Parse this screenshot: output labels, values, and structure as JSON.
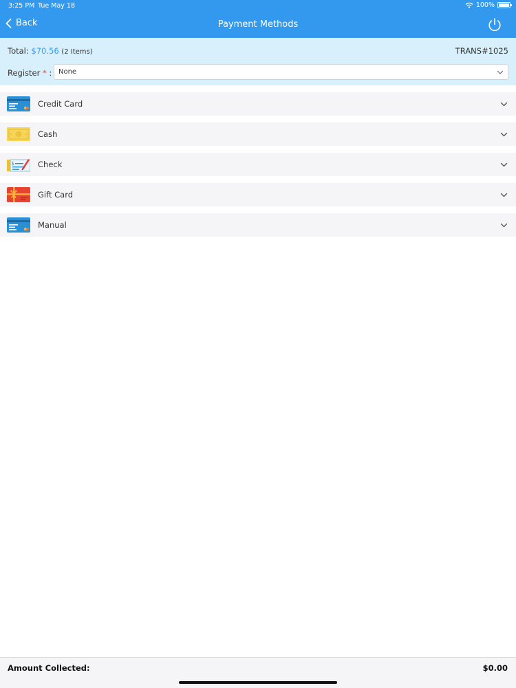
{
  "status_bar": {
    "time": "3:25 PM",
    "date": "Tue May 18",
    "battery_text": "100%",
    "battery_level": 1.0
  },
  "nav": {
    "back_label": "Back",
    "title": "Payment Methods"
  },
  "summary": {
    "total_label": "Total:",
    "total_amount": "$70.56",
    "items_text": "(2 Items)",
    "trans_id": "TRANS#1025",
    "register_label": "Register",
    "required_mark": "*",
    "register_colon": ":",
    "register_value": "None"
  },
  "methods": [
    {
      "label": "Credit Card",
      "icon": "credit-card-icon"
    },
    {
      "label": "Cash",
      "icon": "cash-icon"
    },
    {
      "label": "Check",
      "icon": "check-icon"
    },
    {
      "label": "Gift Card",
      "icon": "gift-card-icon"
    },
    {
      "label": "Manual",
      "icon": "manual-card-icon"
    }
  ],
  "footer": {
    "amount_label": "Amount Collected:",
    "amount_value": "$0.00"
  },
  "colors": {
    "accent": "#3399ee",
    "summary_bg": "#d8f0fc",
    "row_bg": "#f5f4f6",
    "required": "#e54444"
  }
}
